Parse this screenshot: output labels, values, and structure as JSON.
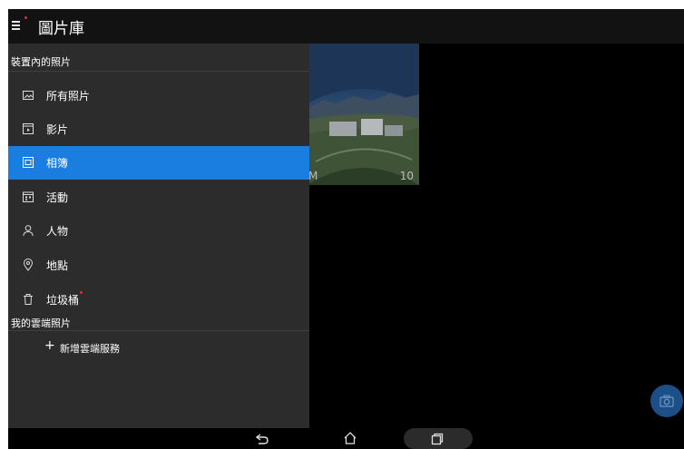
{
  "app": {
    "title": "圖片庫"
  },
  "drawer": {
    "device_section": "裝置內的照片",
    "items": [
      {
        "label": "所有照片",
        "icon": "photo-icon",
        "active": false
      },
      {
        "label": "影片",
        "icon": "video-icon",
        "active": false
      },
      {
        "label": "相簿",
        "icon": "album-icon",
        "active": true
      },
      {
        "label": "活動",
        "icon": "event-icon",
        "active": false
      },
      {
        "label": "人物",
        "icon": "person-icon",
        "active": false
      },
      {
        "label": "地點",
        "icon": "location-pin-icon",
        "active": false
      },
      {
        "label": "垃圾桶",
        "icon": "trash-icon",
        "active": false
      }
    ],
    "cloud_section": "我的雲端照片",
    "add_cloud_service": {
      "plus": "+",
      "label": "新增雲端服務"
    }
  },
  "content": {
    "thumbnail_label_left": "M",
    "thumbnail_label_right": "10"
  },
  "colors": {
    "active_item": "#1a7de0",
    "drawer_bg": "#2c2c2c",
    "appbar_bg": "#121212",
    "fab_bg": "#1c4f88",
    "badge": "#e03030"
  }
}
